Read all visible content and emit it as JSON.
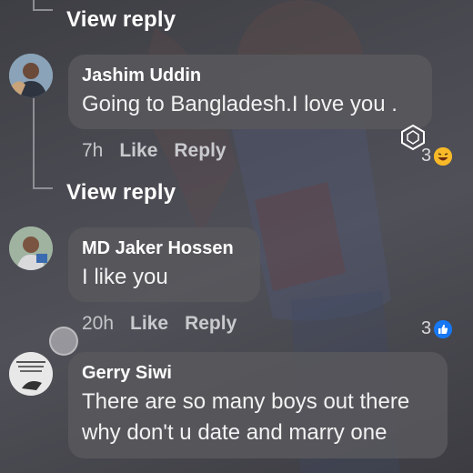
{
  "thread": {
    "view_reply_1": "View reply",
    "view_reply_2": "View reply"
  },
  "comments": [
    {
      "author": "Jashim Uddin",
      "text": "Going to Bangladesh.I love you .",
      "time": "7h",
      "like": "Like",
      "reply": "Reply",
      "reaction_count": "3",
      "reaction_icon": "laugh-emoji-icon"
    },
    {
      "author": "MD Jaker Hossen",
      "text": "I like you",
      "time": "20h",
      "like": "Like",
      "reply": "Reply",
      "reaction_count": "3",
      "reaction_icon": "thumbs-up-icon"
    },
    {
      "author": "Gerry Siwi",
      "text_line1": "There are so many boys out there",
      "text_line2": "why don't u date and marry one"
    }
  ],
  "colors": {
    "like_blue": "#1877f2",
    "laugh_yellow": "#f7b928"
  }
}
